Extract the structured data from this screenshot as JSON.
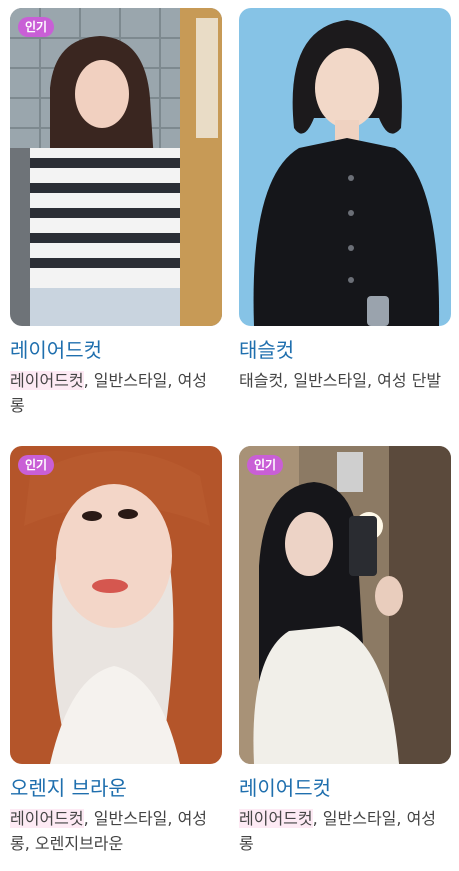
{
  "cards": [
    {
      "badge": "인기",
      "title": "레이어드컷",
      "tags": [
        "레이어드컷",
        "일반스타일",
        "여성 롱"
      ],
      "highlight_first": true
    },
    {
      "badge": "",
      "title": "태슬컷",
      "tags": [
        "태슬컷",
        "일반스타일",
        "여성 단발"
      ],
      "highlight_first": false
    },
    {
      "badge": "인기",
      "title": "오렌지 브라운",
      "tags": [
        "레이어드컷",
        "일반스타일",
        "여성 롱",
        "오렌지브라운"
      ],
      "highlight_first": true
    },
    {
      "badge": "인기",
      "title": "레이어드컷",
      "tags": [
        "레이어드컷",
        "일반스타일",
        "여성 롱"
      ],
      "highlight_first": true
    }
  ],
  "colors": {
    "badge": "#c95fd6",
    "title": "#1f6fae",
    "tag_highlight": "#fdeaf4"
  }
}
